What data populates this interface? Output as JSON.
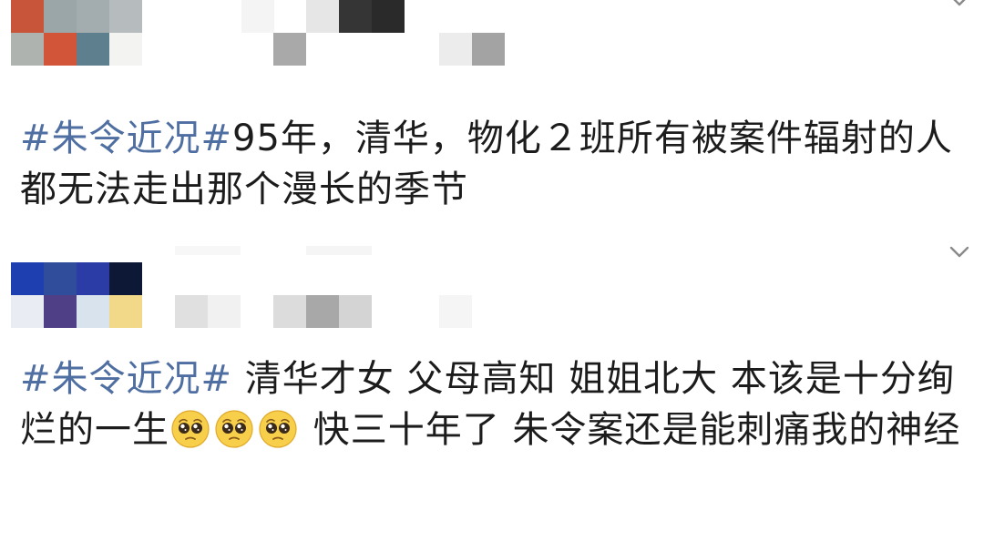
{
  "posts": [
    {
      "hashtag": "#朱令近况#",
      "body": "95年，清华，物化２班所有被案件辐射的人都无法走出那个漫长的季节",
      "emojis": []
    },
    {
      "hashtag": "#朱令近况#",
      "body_before_emoji": " 清华才女 父母高知 姐姐北大 本该是十分绚烂的一生",
      "emojis": [
        "pleading-face-emoji",
        "pleading-face-emoji",
        "pleading-face-emoji"
      ],
      "body_after_emoji": " 快三十年了 朱令案还是能刺痛我的神经"
    }
  ],
  "icons": {
    "expand": "chevron-down-icon"
  },
  "colors": {
    "hashtag": "#4f6ea1",
    "text": "#1c1c1c",
    "background": "#ffffff"
  }
}
